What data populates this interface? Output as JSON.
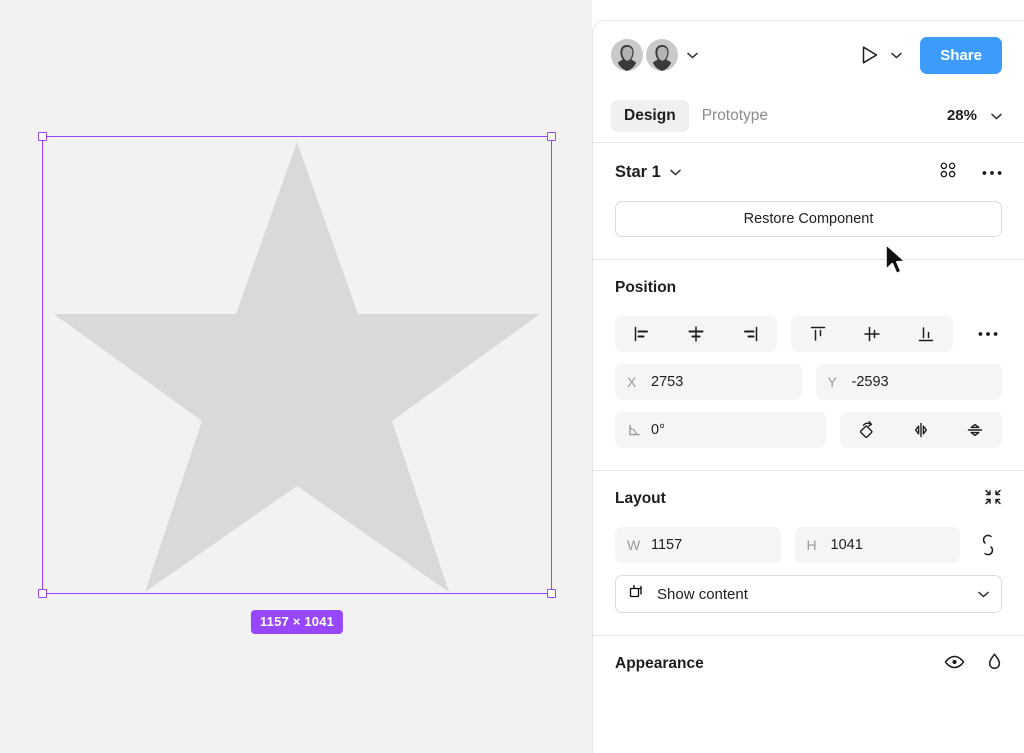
{
  "canvas": {
    "background_color": "#f2f2f2",
    "shape": {
      "name": "star",
      "fill_color": "#d9d9d9"
    },
    "selection": {
      "stroke_color": "#9747ff",
      "size_badge": "1157 × 1041",
      "badge_bg": "#9747ff"
    }
  },
  "panel": {
    "topbar": {
      "avatars_count": 2,
      "avatars_caret": "chevron-down",
      "present_icon": "play-triangle",
      "present_caret": "chevron-down",
      "share_label": "Share",
      "share_color": "#3d9bfb"
    },
    "tabs": [
      {
        "label": "Design",
        "active": true
      },
      {
        "label": "Prototype",
        "active": false
      }
    ],
    "zoom": {
      "value": "28%",
      "caret": "chevron-down"
    },
    "layer": {
      "name": "Star 1",
      "caret": "chevron-down",
      "component_icon": "component-diamond-icon",
      "more_icon": "more-horizontal-icon",
      "restore_label": "Restore Component"
    },
    "position": {
      "title": "Position",
      "align_horizontal": [
        "align-left-icon",
        "align-horizontal-center-icon",
        "align-right-icon"
      ],
      "align_vertical": [
        "align-top-icon",
        "align-vertical-center-icon",
        "align-bottom-icon"
      ],
      "more_icon": "more-horizontal-icon",
      "x_label": "X",
      "x_value": "2753",
      "y_label": "Y",
      "y_value": "-2593",
      "rotation_label": "angle-icon",
      "rotation_value": "0°",
      "transform_icons": [
        "rotate-icon",
        "flip-horizontal-icon",
        "flip-vertical-icon"
      ]
    },
    "layout": {
      "title": "Layout",
      "collapse_icon": "collapse-inward-icon",
      "w_label": "W",
      "w_value": "1157",
      "h_label": "H",
      "h_value": "1041",
      "link_icon": "link-constraint-icon",
      "clip_icon": "frame-clip-icon",
      "clip_label": "Show content",
      "clip_caret": "chevron-down"
    },
    "appearance": {
      "title": "Appearance",
      "visibility_icon": "eye-icon",
      "blend_icon": "blend-drop-icon"
    }
  },
  "cursor": {
    "icon": "arrow-pointer-cursor"
  }
}
